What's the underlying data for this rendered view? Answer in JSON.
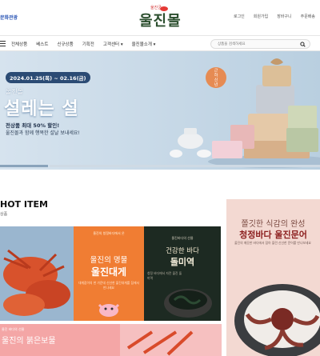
{
  "header": {
    "left_link": "문화관광",
    "logo_text": "울진몰",
    "logo_small": "울진군",
    "right_links": [
      "로그인",
      "회원가입",
      "장바구니",
      "주문배송"
    ]
  },
  "nav": {
    "items": [
      "전체상품",
      "베스트",
      "신규상품",
      "기획전",
      "고객센터 ▾",
      "울진몰소개 ▾"
    ],
    "search_placeholder": "상품을 검색하세요"
  },
  "hero": {
    "date_range": "2024.01.25(목) ~ 02.16(금)",
    "subtitle": "울진몰",
    "title": "설레는 설",
    "discount": "전상품 최대 50% 할인!",
    "message": "울진몰과 함께 행복한 설날 보내세요!",
    "badge": "근하신년"
  },
  "hot_item": {
    "title": "HOT ITEM",
    "subtitle": "상품"
  },
  "cards": {
    "crab": {
      "label": "울진의 청정바다에서 온",
      "title_a": "울진의 명물",
      "title_b": "울진대게",
      "desc": "대게잡이의 한 가운데 신선한 울진대게를 집에서 만나세요"
    },
    "seaweed": {
      "label": "울진바다의 선물",
      "title_a": "건강한 바다",
      "title_b": "돌미역",
      "desc": "청정 바다에서 자란 울진 돌미역"
    },
    "octopus": {
      "title_a": "쫄깃한 식감의 완성",
      "title_b": "청정바다 울진문어",
      "desc": "울진의 깨끗한 바다에서 잡아 올린 신선한 문어를 만나보세요"
    },
    "bottom": {
      "label": "울진 바다의 선물",
      "title": "울진의 붉은보물"
    }
  },
  "colors": {
    "accent": "#2a55b5",
    "crab_bg": "#f07d33",
    "seaweed_bg": "#1d2a22",
    "octopus_bg": "#f3d9d2",
    "hero_date_bg": "#2b4b74"
  }
}
